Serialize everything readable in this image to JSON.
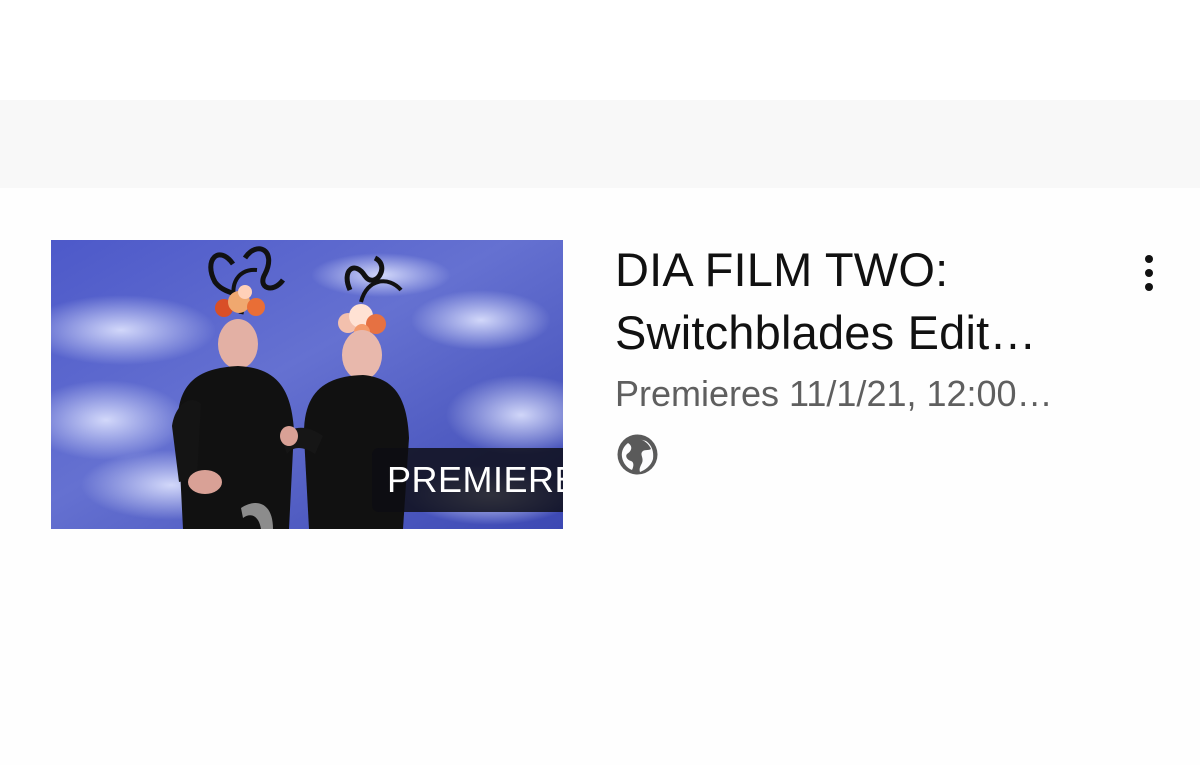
{
  "video": {
    "title_line1": "DIA FILM TWO:",
    "title_line2": "Switchblades Edit…",
    "meta": "Premieres 11/1/21, 12:00…",
    "badge": "PREMIERE",
    "visibility_icon": "globe-icon",
    "menu_icon": "more-vertical-icon"
  },
  "colors": {
    "page_background": "#fcfcfd",
    "title_text": "#111111",
    "meta_text": "#5f5f5f",
    "badge_background": "#111118",
    "thumbnail_sky": "#4a56c2"
  }
}
